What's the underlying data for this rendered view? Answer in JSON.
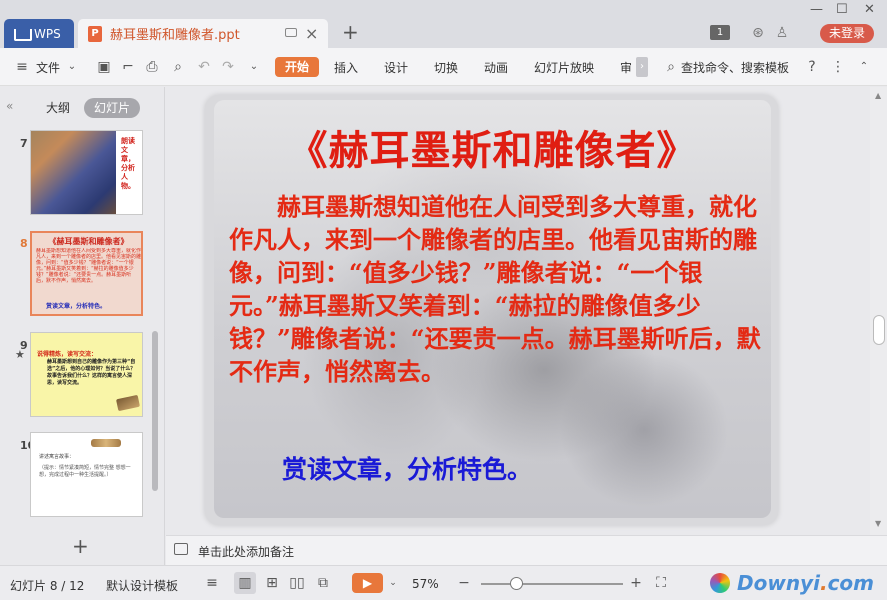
{
  "titlebar": {
    "app_tab_label": "WPS",
    "doc_tab_title": "赫耳墨斯和雕像者.ppt",
    "window_count": "1",
    "login_label": "未登录"
  },
  "menubar": {
    "file_label": "文件",
    "tabs": [
      "开始",
      "插入",
      "设计",
      "切换",
      "动画",
      "幻灯片放映",
      "审"
    ],
    "search_label": "查找命令、搜索模板"
  },
  "sidebar": {
    "tab_outline": "大纲",
    "tab_slides": "幻灯片",
    "slides": [
      {
        "num": "7",
        "text": "朗读文章，分析人物。"
      },
      {
        "num": "8",
        "title": "《赫耳墨斯和雕像者》",
        "body": "赫耳墨斯想知道他在人间受到多大尊重，就化作凡人，来到一个雕像者的店里。他看见宙斯的雕像，问到：“值多少钱？”雕像者说：“一个银元。”赫耳墨斯又笑着到：“赫拉的雕像值多少钱？”雕像者说：“还要贵一点。赫耳墨斯听后，默不作声，悄然离去。",
        "foot": "赏读文章，分析特色。"
      },
      {
        "num": "9",
        "head": "说得精炼，读写交流：",
        "body": "赫耳墨斯想到自己的雕像作为第三种“自选”之后，他的心理如何？当说了什么？故事告诉我们什么？这样的寓言使人深思，读写交流。"
      },
      {
        "num": "10",
        "head": "讲述寓言故事：",
        "body": "（提示：情节紧凑简短，情节完整 想想一想，完成过程中一种生活提醒。）"
      }
    ]
  },
  "slide": {
    "title": "《赫耳墨斯和雕像者》",
    "body": "赫耳墨斯想知道他在人间受到多大尊重，就化作凡人，来到一个雕像者的店里。他看见宙斯的雕像，问到：“值多少钱？”雕像者说：“一个银元。”赫耳墨斯又笑着到：“赫拉的雕像值多少钱？”雕像者说：“还要贵一点。赫耳墨斯听后，默不作声，悄然离去。",
    "foot": "赏读文章，分析特色。"
  },
  "notes": {
    "placeholder": "单击此处添加备注"
  },
  "status": {
    "slide_counter": "幻灯片 8 / 12",
    "template_label": "默认设计模板",
    "zoom": "57%",
    "brand_main": "Downyi",
    "brand_dot": ".",
    "brand_tail": "com"
  },
  "colors": {
    "accent": "#e8773b",
    "title_red": "#e01e12",
    "foot_blue": "#1a1ad6",
    "wps_blue": "#3a5fa8"
  }
}
